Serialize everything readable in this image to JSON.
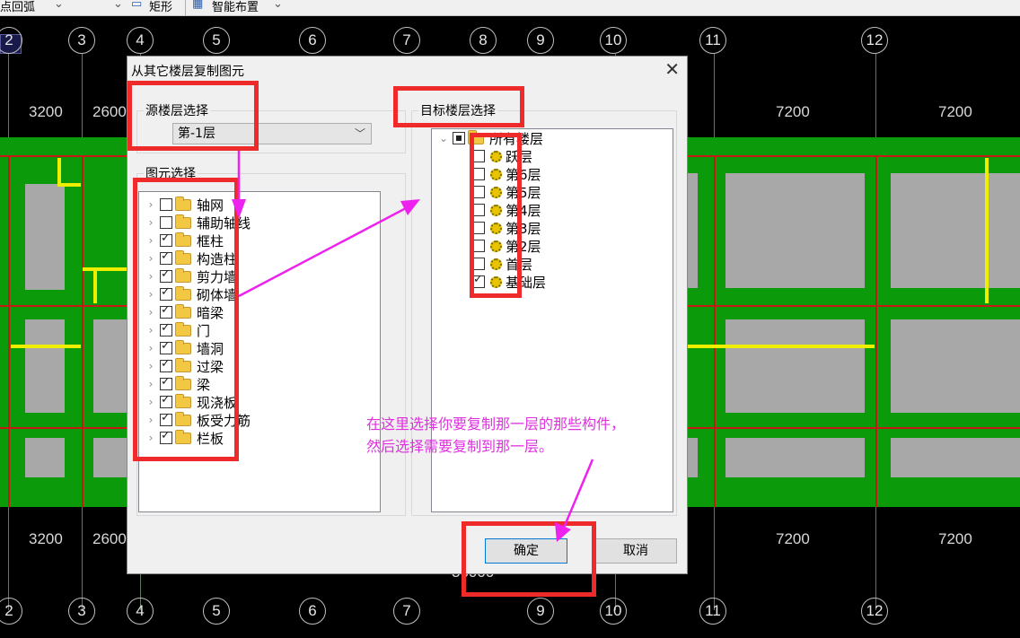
{
  "toolbar": {
    "arc_label": "点回弧",
    "rect_label": "矩形",
    "smart_label": "智能布置"
  },
  "canvas": {
    "axis_top": [
      "2",
      "3",
      "4",
      "5",
      "6",
      "7",
      "8",
      "9",
      "10",
      "11",
      "12"
    ],
    "axis_bottom": [
      "2",
      "3",
      "4",
      "5",
      "6",
      "7",
      "9",
      "10",
      "11",
      "12"
    ],
    "dims_top": [
      "3200",
      "2600",
      "7200",
      "7200"
    ],
    "dims_bottom": [
      "3200",
      "2600",
      "7200",
      "7200"
    ],
    "bottom_total": "36000"
  },
  "dialog": {
    "title": "从其它楼层复制图元",
    "close": "✕",
    "source_label": "源楼层选择",
    "source_value": "第-1层",
    "element_label": "图元选择",
    "elements": [
      {
        "label": "轴网",
        "checked": false
      },
      {
        "label": "辅助轴线",
        "checked": false
      },
      {
        "label": "框柱",
        "checked": true
      },
      {
        "label": "构造柱",
        "checked": true
      },
      {
        "label": "剪力墙",
        "checked": true
      },
      {
        "label": "砌体墙",
        "checked": true
      },
      {
        "label": "暗梁",
        "checked": true
      },
      {
        "label": "门",
        "checked": true
      },
      {
        "label": "墙洞",
        "checked": true
      },
      {
        "label": "过梁",
        "checked": true
      },
      {
        "label": "梁",
        "checked": true
      },
      {
        "label": "现浇板",
        "checked": true
      },
      {
        "label": "板受力筋",
        "checked": true
      },
      {
        "label": "栏板",
        "checked": true
      }
    ],
    "target_label": "目标楼层选择",
    "target_root": "所有楼层",
    "targets": [
      {
        "label": "跃层",
        "checked": false
      },
      {
        "label": "第6层",
        "checked": false
      },
      {
        "label": "第5层",
        "checked": false
      },
      {
        "label": "第4层",
        "checked": false
      },
      {
        "label": "第3层",
        "checked": false
      },
      {
        "label": "第2层",
        "checked": false
      },
      {
        "label": "首层",
        "checked": false
      },
      {
        "label": "基础层",
        "checked": true
      }
    ],
    "ok_label": "确定",
    "cancel_label": "取消"
  },
  "annotation": {
    "line1": "在这里选择你要复制那一层的那些构件，",
    "line2": "然后选择需要复制到那一层。",
    "color": "#e030e0",
    "box_color": "#ee2a2a"
  }
}
